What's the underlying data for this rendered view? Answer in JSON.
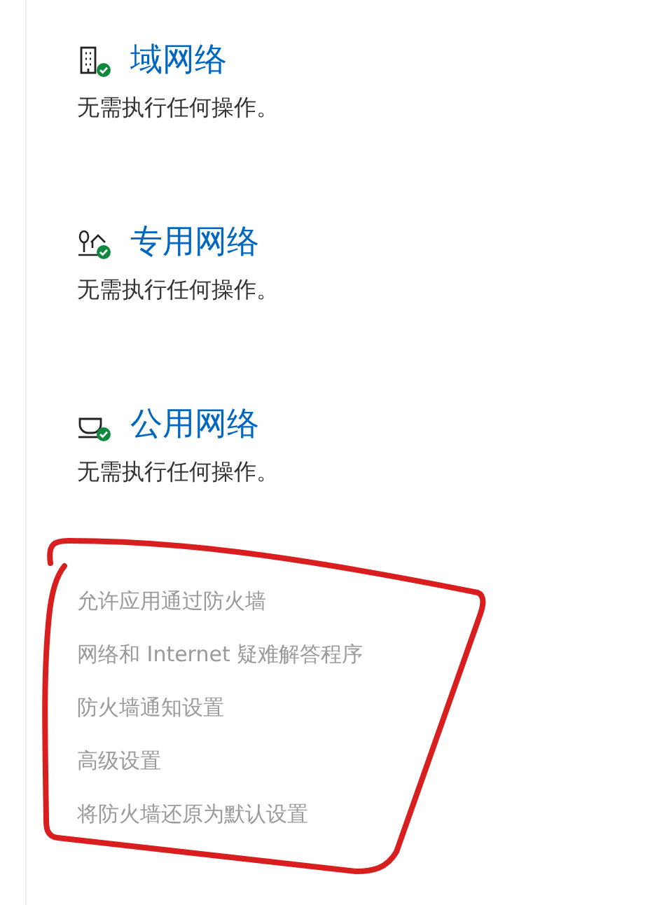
{
  "networks": [
    {
      "kind": "domain",
      "title": "域网络",
      "status": "无需执行任何操作。",
      "protected": true
    },
    {
      "kind": "private",
      "title": "专用网络",
      "status": "无需执行任何操作。",
      "protected": true
    },
    {
      "kind": "public",
      "title": "公用网络",
      "status": "无需执行任何操作。",
      "protected": true
    }
  ],
  "links": [
    {
      "label": "允许应用通过防火墙",
      "disabled": true
    },
    {
      "label": "网络和 Internet 疑难解答程序",
      "disabled": true
    },
    {
      "label": "防火墙通知设置",
      "disabled": true
    },
    {
      "label": "高级设置",
      "disabled": true
    },
    {
      "label": "将防火墙还原为默认设置",
      "disabled": true
    }
  ]
}
